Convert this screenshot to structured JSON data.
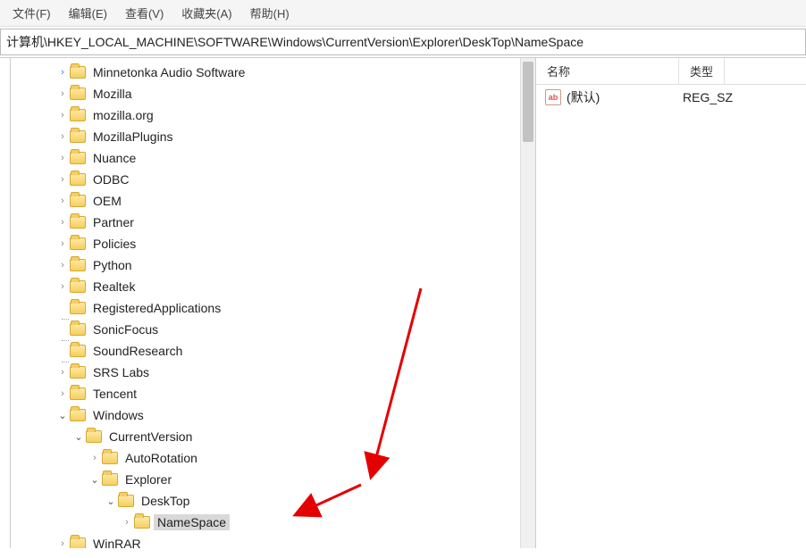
{
  "menu": {
    "file": "文件(F)",
    "edit": "编辑(E)",
    "view": "查看(V)",
    "favorites": "收藏夹(A)",
    "help": "帮助(H)"
  },
  "address": "计算机\\HKEY_LOCAL_MACHINE\\SOFTWARE\\Windows\\CurrentVersion\\Explorer\\DeskTop\\NameSpace",
  "tree": [
    {
      "label": "Minnetonka Audio Software",
      "depth": 3,
      "arrow": "collapsed-blue"
    },
    {
      "label": "Mozilla",
      "depth": 3,
      "arrow": "collapsed"
    },
    {
      "label": "mozilla.org",
      "depth": 3,
      "arrow": "collapsed"
    },
    {
      "label": "MozillaPlugins",
      "depth": 3,
      "arrow": "collapsed"
    },
    {
      "label": "Nuance",
      "depth": 3,
      "arrow": "collapsed"
    },
    {
      "label": "ODBC",
      "depth": 3,
      "arrow": "collapsed"
    },
    {
      "label": "OEM",
      "depth": 3,
      "arrow": "collapsed"
    },
    {
      "label": "Partner",
      "depth": 3,
      "arrow": "collapsed"
    },
    {
      "label": "Policies",
      "depth": 3,
      "arrow": "collapsed"
    },
    {
      "label": "Python",
      "depth": 3,
      "arrow": "collapsed"
    },
    {
      "label": "Realtek",
      "depth": 3,
      "arrow": "collapsed"
    },
    {
      "label": "RegisteredApplications",
      "depth": 3,
      "arrow": "leaf"
    },
    {
      "label": "SonicFocus",
      "depth": 3,
      "arrow": "leaf"
    },
    {
      "label": "SoundResearch",
      "depth": 3,
      "arrow": "leaf"
    },
    {
      "label": "SRS Labs",
      "depth": 3,
      "arrow": "collapsed"
    },
    {
      "label": "Tencent",
      "depth": 3,
      "arrow": "collapsed"
    },
    {
      "label": "Windows",
      "depth": 3,
      "arrow": "expanded"
    },
    {
      "label": "CurrentVersion",
      "depth": 4,
      "arrow": "expanded"
    },
    {
      "label": "AutoRotation",
      "depth": 5,
      "arrow": "collapsed"
    },
    {
      "label": "Explorer",
      "depth": 5,
      "arrow": "expanded"
    },
    {
      "label": "DeskTop",
      "depth": 6,
      "arrow": "expanded"
    },
    {
      "label": "NameSpace",
      "depth": 7,
      "arrow": "collapsed",
      "selected": true
    },
    {
      "label": "WinRAR",
      "depth": 3,
      "arrow": "collapsed"
    }
  ],
  "columns": {
    "name": "名称",
    "type": "类型"
  },
  "values": [
    {
      "name": "(默认)",
      "type": "REG_SZ"
    }
  ],
  "icons": {
    "string_value": "ab"
  }
}
